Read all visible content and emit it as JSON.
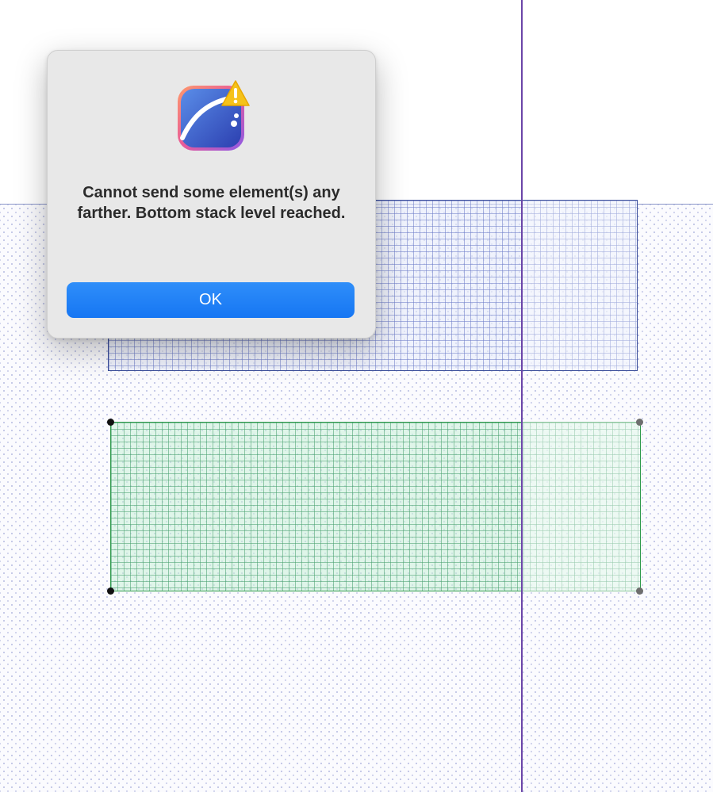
{
  "dialog": {
    "message": "Cannot send some element(s) any farther. Bottom stack level reached.",
    "ok_label": "OK",
    "app_icon": "vector-app-icon",
    "badge_icon": "warning-triangle-icon"
  },
  "canvas": {
    "guide_color": "#6b45a8",
    "blue_shape_color": "#3a4d9a",
    "green_shape_color": "#2e9a4a"
  }
}
